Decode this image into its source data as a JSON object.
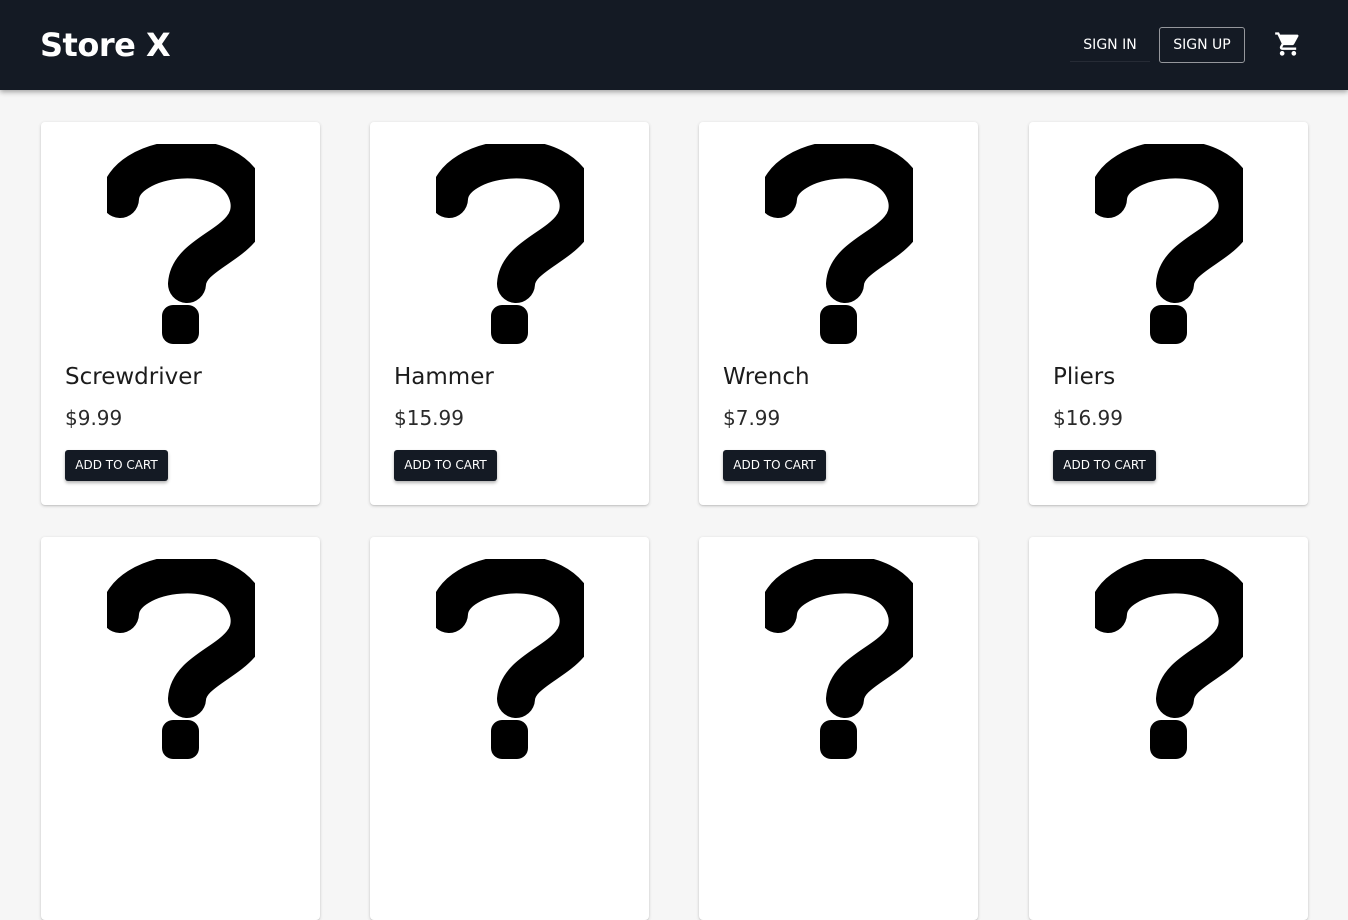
{
  "header": {
    "brand": "Store X",
    "sign_in_label": "SIGN IN",
    "sign_up_label": "SIGN UP",
    "cart_icon": "shopping-cart-icon"
  },
  "colors": {
    "appbar": "#141a24",
    "page_background": "#f6f6f6",
    "card_background": "#ffffff",
    "button": "#141a24"
  },
  "products": [
    {
      "name": "Screwdriver",
      "price": "$9.99",
      "button": "ADD TO CART",
      "image_icon": "question-mark-icon"
    },
    {
      "name": "Hammer",
      "price": "$15.99",
      "button": "ADD TO CART",
      "image_icon": "question-mark-icon"
    },
    {
      "name": "Wrench",
      "price": "$7.99",
      "button": "ADD TO CART",
      "image_icon": "question-mark-icon"
    },
    {
      "name": "Pliers",
      "price": "$16.99",
      "button": "ADD TO CART",
      "image_icon": "question-mark-icon"
    },
    {
      "image_icon": "question-mark-icon"
    },
    {
      "image_icon": "question-mark-icon"
    },
    {
      "image_icon": "question-mark-icon"
    },
    {
      "image_icon": "question-mark-icon"
    }
  ]
}
